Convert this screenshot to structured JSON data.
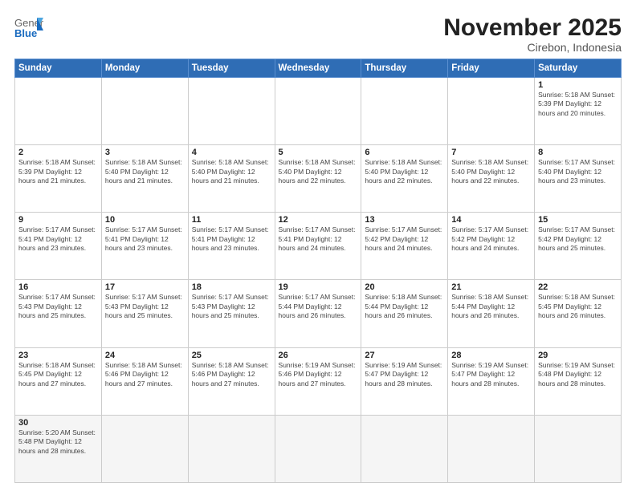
{
  "header": {
    "logo_general": "General",
    "logo_blue": "Blue",
    "month_title": "November 2025",
    "subtitle": "Cirebon, Indonesia"
  },
  "weekdays": [
    "Sunday",
    "Monday",
    "Tuesday",
    "Wednesday",
    "Thursday",
    "Friday",
    "Saturday"
  ],
  "weeks": [
    [
      {
        "day": "",
        "info": ""
      },
      {
        "day": "",
        "info": ""
      },
      {
        "day": "",
        "info": ""
      },
      {
        "day": "",
        "info": ""
      },
      {
        "day": "",
        "info": ""
      },
      {
        "day": "",
        "info": ""
      },
      {
        "day": "1",
        "info": "Sunrise: 5:18 AM\nSunset: 5:39 PM\nDaylight: 12 hours\nand 20 minutes."
      }
    ],
    [
      {
        "day": "2",
        "info": "Sunrise: 5:18 AM\nSunset: 5:39 PM\nDaylight: 12 hours\nand 21 minutes."
      },
      {
        "day": "3",
        "info": "Sunrise: 5:18 AM\nSunset: 5:40 PM\nDaylight: 12 hours\nand 21 minutes."
      },
      {
        "day": "4",
        "info": "Sunrise: 5:18 AM\nSunset: 5:40 PM\nDaylight: 12 hours\nand 21 minutes."
      },
      {
        "day": "5",
        "info": "Sunrise: 5:18 AM\nSunset: 5:40 PM\nDaylight: 12 hours\nand 22 minutes."
      },
      {
        "day": "6",
        "info": "Sunrise: 5:18 AM\nSunset: 5:40 PM\nDaylight: 12 hours\nand 22 minutes."
      },
      {
        "day": "7",
        "info": "Sunrise: 5:18 AM\nSunset: 5:40 PM\nDaylight: 12 hours\nand 22 minutes."
      },
      {
        "day": "8",
        "info": "Sunrise: 5:17 AM\nSunset: 5:40 PM\nDaylight: 12 hours\nand 23 minutes."
      }
    ],
    [
      {
        "day": "9",
        "info": "Sunrise: 5:17 AM\nSunset: 5:41 PM\nDaylight: 12 hours\nand 23 minutes."
      },
      {
        "day": "10",
        "info": "Sunrise: 5:17 AM\nSunset: 5:41 PM\nDaylight: 12 hours\nand 23 minutes."
      },
      {
        "day": "11",
        "info": "Sunrise: 5:17 AM\nSunset: 5:41 PM\nDaylight: 12 hours\nand 23 minutes."
      },
      {
        "day": "12",
        "info": "Sunrise: 5:17 AM\nSunset: 5:41 PM\nDaylight: 12 hours\nand 24 minutes."
      },
      {
        "day": "13",
        "info": "Sunrise: 5:17 AM\nSunset: 5:42 PM\nDaylight: 12 hours\nand 24 minutes."
      },
      {
        "day": "14",
        "info": "Sunrise: 5:17 AM\nSunset: 5:42 PM\nDaylight: 12 hours\nand 24 minutes."
      },
      {
        "day": "15",
        "info": "Sunrise: 5:17 AM\nSunset: 5:42 PM\nDaylight: 12 hours\nand 25 minutes."
      }
    ],
    [
      {
        "day": "16",
        "info": "Sunrise: 5:17 AM\nSunset: 5:43 PM\nDaylight: 12 hours\nand 25 minutes."
      },
      {
        "day": "17",
        "info": "Sunrise: 5:17 AM\nSunset: 5:43 PM\nDaylight: 12 hours\nand 25 minutes."
      },
      {
        "day": "18",
        "info": "Sunrise: 5:17 AM\nSunset: 5:43 PM\nDaylight: 12 hours\nand 25 minutes."
      },
      {
        "day": "19",
        "info": "Sunrise: 5:17 AM\nSunset: 5:44 PM\nDaylight: 12 hours\nand 26 minutes."
      },
      {
        "day": "20",
        "info": "Sunrise: 5:18 AM\nSunset: 5:44 PM\nDaylight: 12 hours\nand 26 minutes."
      },
      {
        "day": "21",
        "info": "Sunrise: 5:18 AM\nSunset: 5:44 PM\nDaylight: 12 hours\nand 26 minutes."
      },
      {
        "day": "22",
        "info": "Sunrise: 5:18 AM\nSunset: 5:45 PM\nDaylight: 12 hours\nand 26 minutes."
      }
    ],
    [
      {
        "day": "23",
        "info": "Sunrise: 5:18 AM\nSunset: 5:45 PM\nDaylight: 12 hours\nand 27 minutes."
      },
      {
        "day": "24",
        "info": "Sunrise: 5:18 AM\nSunset: 5:46 PM\nDaylight: 12 hours\nand 27 minutes."
      },
      {
        "day": "25",
        "info": "Sunrise: 5:18 AM\nSunset: 5:46 PM\nDaylight: 12 hours\nand 27 minutes."
      },
      {
        "day": "26",
        "info": "Sunrise: 5:19 AM\nSunset: 5:46 PM\nDaylight: 12 hours\nand 27 minutes."
      },
      {
        "day": "27",
        "info": "Sunrise: 5:19 AM\nSunset: 5:47 PM\nDaylight: 12 hours\nand 28 minutes."
      },
      {
        "day": "28",
        "info": "Sunrise: 5:19 AM\nSunset: 5:47 PM\nDaylight: 12 hours\nand 28 minutes."
      },
      {
        "day": "29",
        "info": "Sunrise: 5:19 AM\nSunset: 5:48 PM\nDaylight: 12 hours\nand 28 minutes."
      }
    ],
    [
      {
        "day": "30",
        "info": "Sunrise: 5:20 AM\nSunset: 5:48 PM\nDaylight: 12 hours\nand 28 minutes."
      },
      {
        "day": "",
        "info": ""
      },
      {
        "day": "",
        "info": ""
      },
      {
        "day": "",
        "info": ""
      },
      {
        "day": "",
        "info": ""
      },
      {
        "day": "",
        "info": ""
      },
      {
        "day": "",
        "info": ""
      }
    ]
  ]
}
